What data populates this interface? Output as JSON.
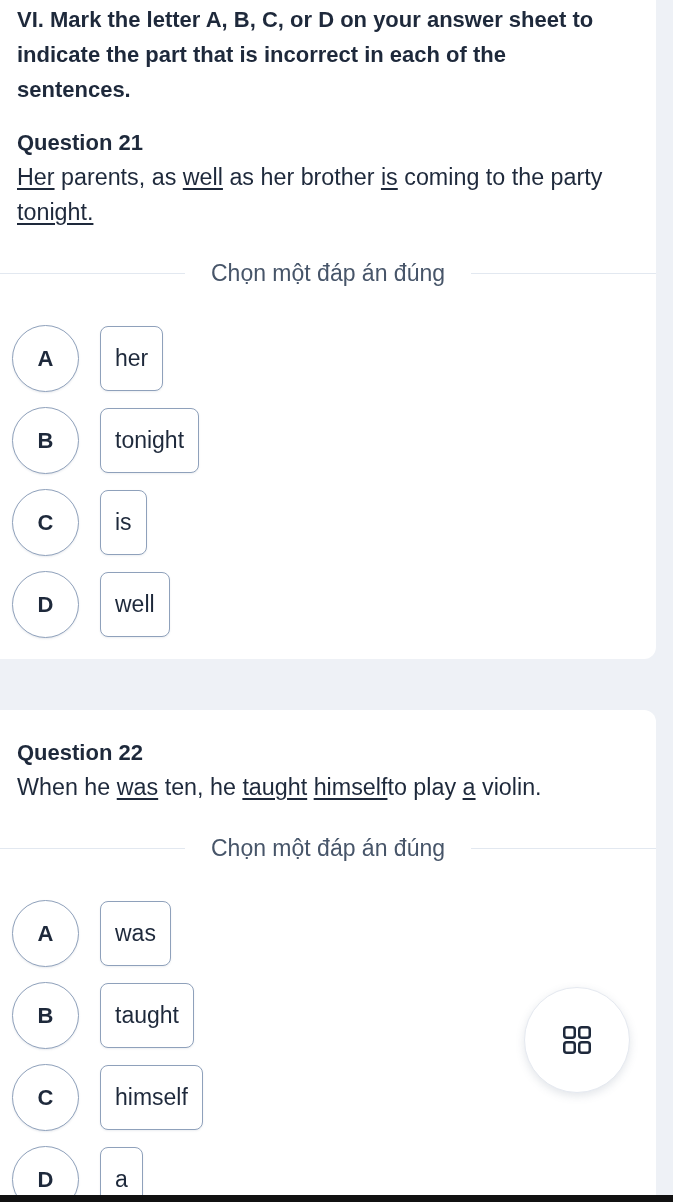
{
  "instruction": "VI. Mark the letter A, B, C, or D on your answer sheet to indicate the part that is incorrect in each of the sentences.",
  "questions": [
    {
      "title": "Question 21",
      "parts": [
        {
          "text": "Her",
          "underlined": true
        },
        {
          "text": " parents, as ",
          "underlined": false
        },
        {
          "text": "well",
          "underlined": true
        },
        {
          "text": " as her brother ",
          "underlined": false
        },
        {
          "text": "is",
          "underlined": true
        },
        {
          "text": " coming to the party ",
          "underlined": false
        },
        {
          "text": "tonight.",
          "underlined": true
        }
      ],
      "prompt": "Chọn một đáp án đúng",
      "options": [
        {
          "letter": "A",
          "text": "her",
          "selected": false
        },
        {
          "letter": "B",
          "text": "tonight",
          "selected": false
        },
        {
          "letter": "C",
          "text": "is",
          "selected": false
        },
        {
          "letter": "D",
          "text": "well",
          "selected": false
        }
      ]
    },
    {
      "title": "Question 22",
      "parts": [
        {
          "text": "When he ",
          "underlined": false
        },
        {
          "text": "was",
          "underlined": true
        },
        {
          "text": " ten, he ",
          "underlined": false
        },
        {
          "text": "taught",
          "underlined": true
        },
        {
          "text": " himself",
          "underlined": true
        },
        {
          "text": "to play ",
          "underlined": false
        },
        {
          "text": "a",
          "underlined": true
        },
        {
          "text": " violin.",
          "underlined": false
        }
      ],
      "prompt": "Chọn một đáp án đúng",
      "options": [
        {
          "letter": "A",
          "text": "was",
          "selected": false
        },
        {
          "letter": "B",
          "text": "taught",
          "selected": false
        },
        {
          "letter": "C",
          "text": "himself",
          "selected": false
        },
        {
          "letter": "D",
          "text": "a",
          "selected": false
        }
      ]
    }
  ]
}
